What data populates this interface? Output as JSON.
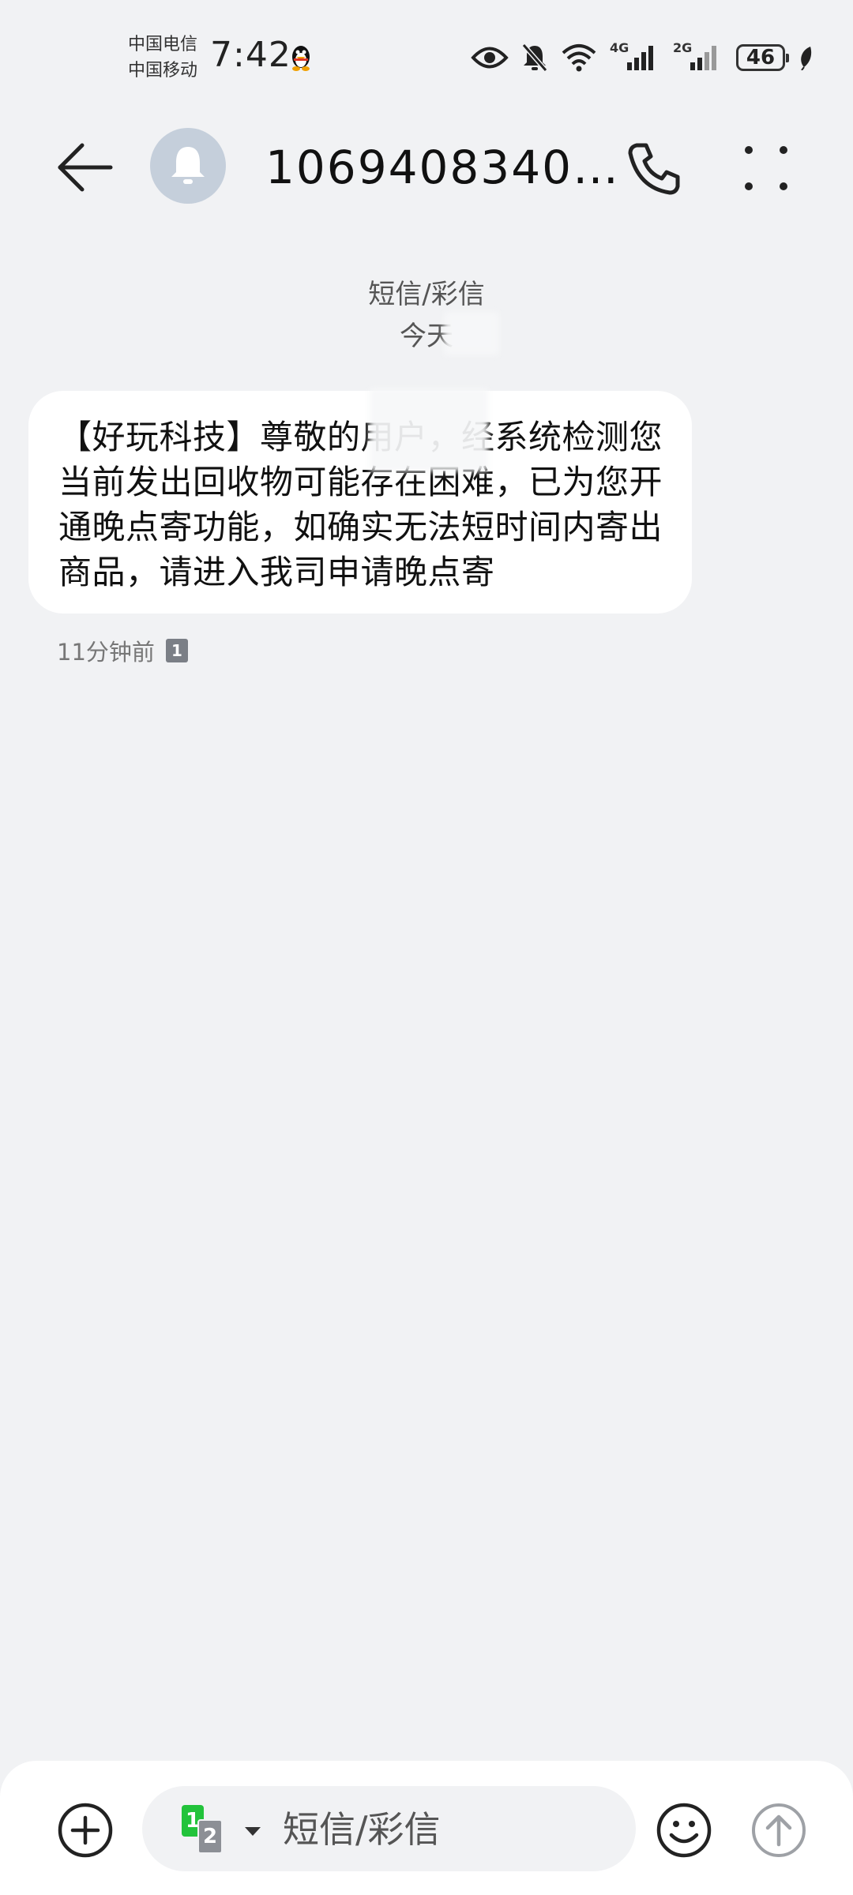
{
  "status_bar": {
    "carrier_1": "中国电信",
    "carrier_2": "中国移动",
    "time": "7:42",
    "net_1": "4G",
    "net_2": "2G",
    "battery_level": "46"
  },
  "header": {
    "contact_name": "1069408340…"
  },
  "thread": {
    "type_label": "短信/彩信",
    "date_label": "今天"
  },
  "message": {
    "text": "【好玩科技】尊敬的用户，经系统检测您当前发出回收物可能存在困难，已为您开通晚点寄功能，如确实无法短时间内寄出商品，请进入我司申请晚点寄",
    "time_ago": "11分钟前",
    "sim_slot": "1"
  },
  "compose": {
    "placeholder": "短信/彩信",
    "sim_primary": "1",
    "sim_secondary": "2"
  },
  "colors": {
    "background": "#f1f2f4",
    "bubble": "#ffffff",
    "avatar": "#c5cfdb",
    "sim_green": "#22c33b"
  }
}
